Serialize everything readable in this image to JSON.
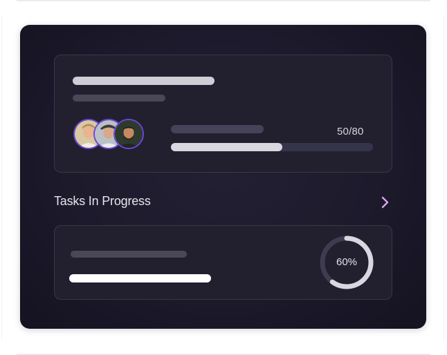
{
  "summary_card": {
    "progress_value": "50/80",
    "progress_fraction": 0.55,
    "avatars": [
      "avatar-1",
      "avatar-2",
      "avatar-3"
    ]
  },
  "tasks_section": {
    "title": "Tasks In Progress",
    "chevron_icon": "chevron-right-icon"
  },
  "task_card": {
    "ring_label": "60%",
    "ring_fraction": 0.6
  },
  "colors": {
    "panel_background": "#1c1a2b",
    "card_background": "#22202f",
    "avatar_border": "#6b46d9",
    "chevron": "#d7a6e8",
    "ring_fill": "#d9d7df",
    "ring_track": "#3e3c4e"
  }
}
